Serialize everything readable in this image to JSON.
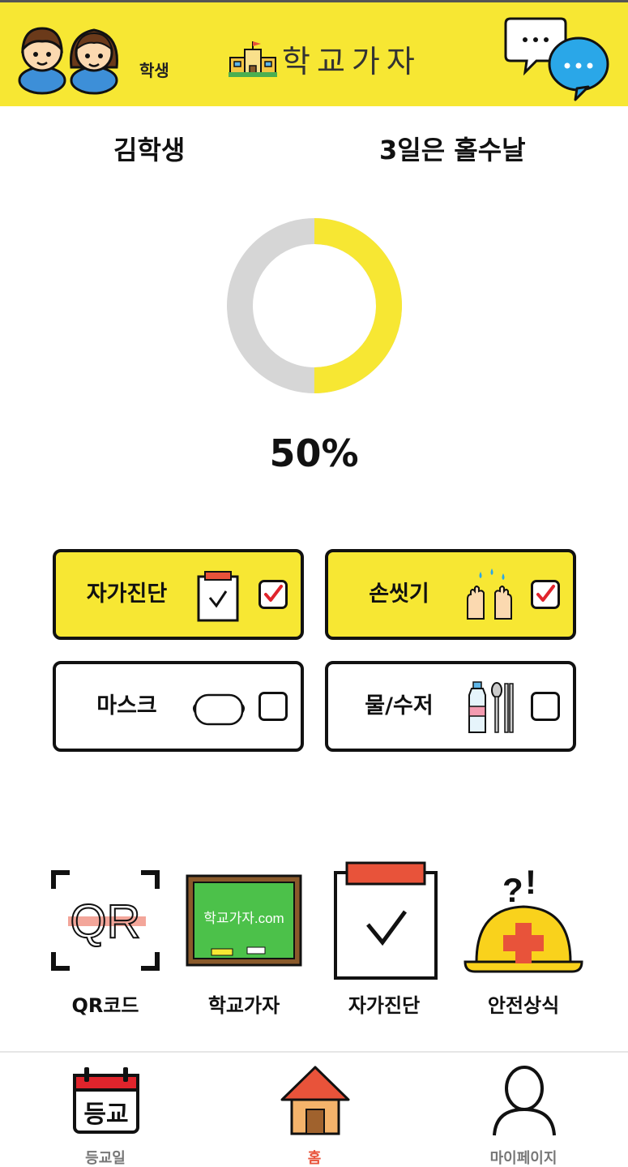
{
  "header": {
    "role_label": "학생",
    "app_title": "학교가자",
    "colors": {
      "bar": "#f7e733",
      "accent": "#e8533a"
    }
  },
  "summary": {
    "student_name": "김학생",
    "dday_text": "3일은 홀수날",
    "progress_value": 0.5,
    "progress_text": "50%"
  },
  "checklist": [
    {
      "label": "자가진단",
      "checked": true,
      "icon": "clipboard-icon"
    },
    {
      "label": "손씻기",
      "checked": true,
      "icon": "washing-hands-icon"
    },
    {
      "label": "마스크",
      "checked": false,
      "icon": "mask-icon"
    },
    {
      "label": "물/수저",
      "checked": false,
      "icon": "water-bottle-spoon-icon"
    }
  ],
  "shortcuts": [
    {
      "label": "QR코드",
      "icon": "qr-code-icon"
    },
    {
      "label": "학교가자",
      "icon": "chalkboard-icon",
      "board_text": "학교가자.com"
    },
    {
      "label": "자가진단",
      "icon": "clipboard-check-icon"
    },
    {
      "label": "안전상식",
      "icon": "safety-helmet-icon"
    }
  ],
  "bottom_nav": [
    {
      "label": "등교일",
      "icon": "calendar-icon",
      "icon_text": "등교",
      "active": false
    },
    {
      "label": "홈",
      "icon": "house-icon",
      "active": true
    },
    {
      "label": "마이페이지",
      "icon": "person-icon",
      "active": false
    }
  ],
  "qr_icon_text": "QR"
}
